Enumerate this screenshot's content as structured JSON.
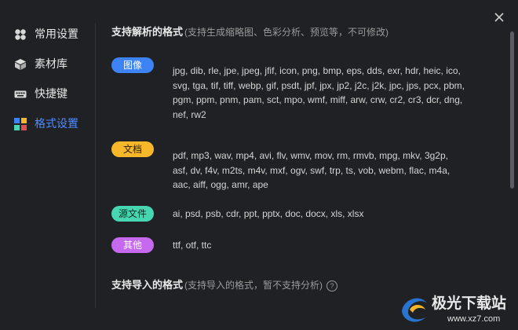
{
  "sidebar": {
    "items": [
      {
        "label": "常用设置",
        "icon": "clover-icon",
        "active": false
      },
      {
        "label": "素材库",
        "icon": "cube-icon",
        "active": false
      },
      {
        "label": "快捷键",
        "icon": "keyboard-icon",
        "active": false
      },
      {
        "label": "格式设置",
        "icon": "grid-color-icon",
        "active": true
      }
    ]
  },
  "main": {
    "parse_title": "支持解析的格式",
    "parse_note": "(支持生成缩略图、色彩分析、预览等，不可修改)",
    "categories": [
      {
        "tag": "图像",
        "formats": "jpg, dib, rle, jpe, jpeg, jfif, icon, png, bmp, eps, dds, exr, hdr, heic, ico, svg, tga, tif, tiff, webp, gif, psdt, jpf, jpx, jp2, j2c, j2k, jpc, jps, pcx, pbm, pgm, ppm, pnm, pam, sct, mpo, wmf, miff, arw, crw, cr2, cr3, dcr, dng, nef, rw2"
      },
      {
        "tag": "文档",
        "formats": "pdf, mp3, wav, mp4, avi, flv, wmv, mov, rm, rmvb, mpg, mkv, 3g2p, asf, dv, f4v, m2ts, m4v, mxf, ogv, swf, trp, ts, vob, webm, flac, m4a, aac, aiff, ogg, amr, ape"
      },
      {
        "tag": "源文件",
        "formats": "ai, psd, psb, cdr, ppt, pptx, doc, docx, xls, xlsx"
      },
      {
        "tag": "其他",
        "formats": "ttf, otf, ttc"
      }
    ],
    "import_title": "支持导入的格式",
    "import_note": "(支持导入的格式，暂不支持分析)",
    "help": "?"
  },
  "watermark": {
    "text": "极光下载站",
    "url": "www.xz7.com"
  },
  "colors": {
    "accent": "#4f8cff",
    "tag_image": "#3d83f3",
    "tag_doc": "#f6b72a",
    "tag_source": "#46d6b1",
    "tag_other": "#c769ef"
  }
}
